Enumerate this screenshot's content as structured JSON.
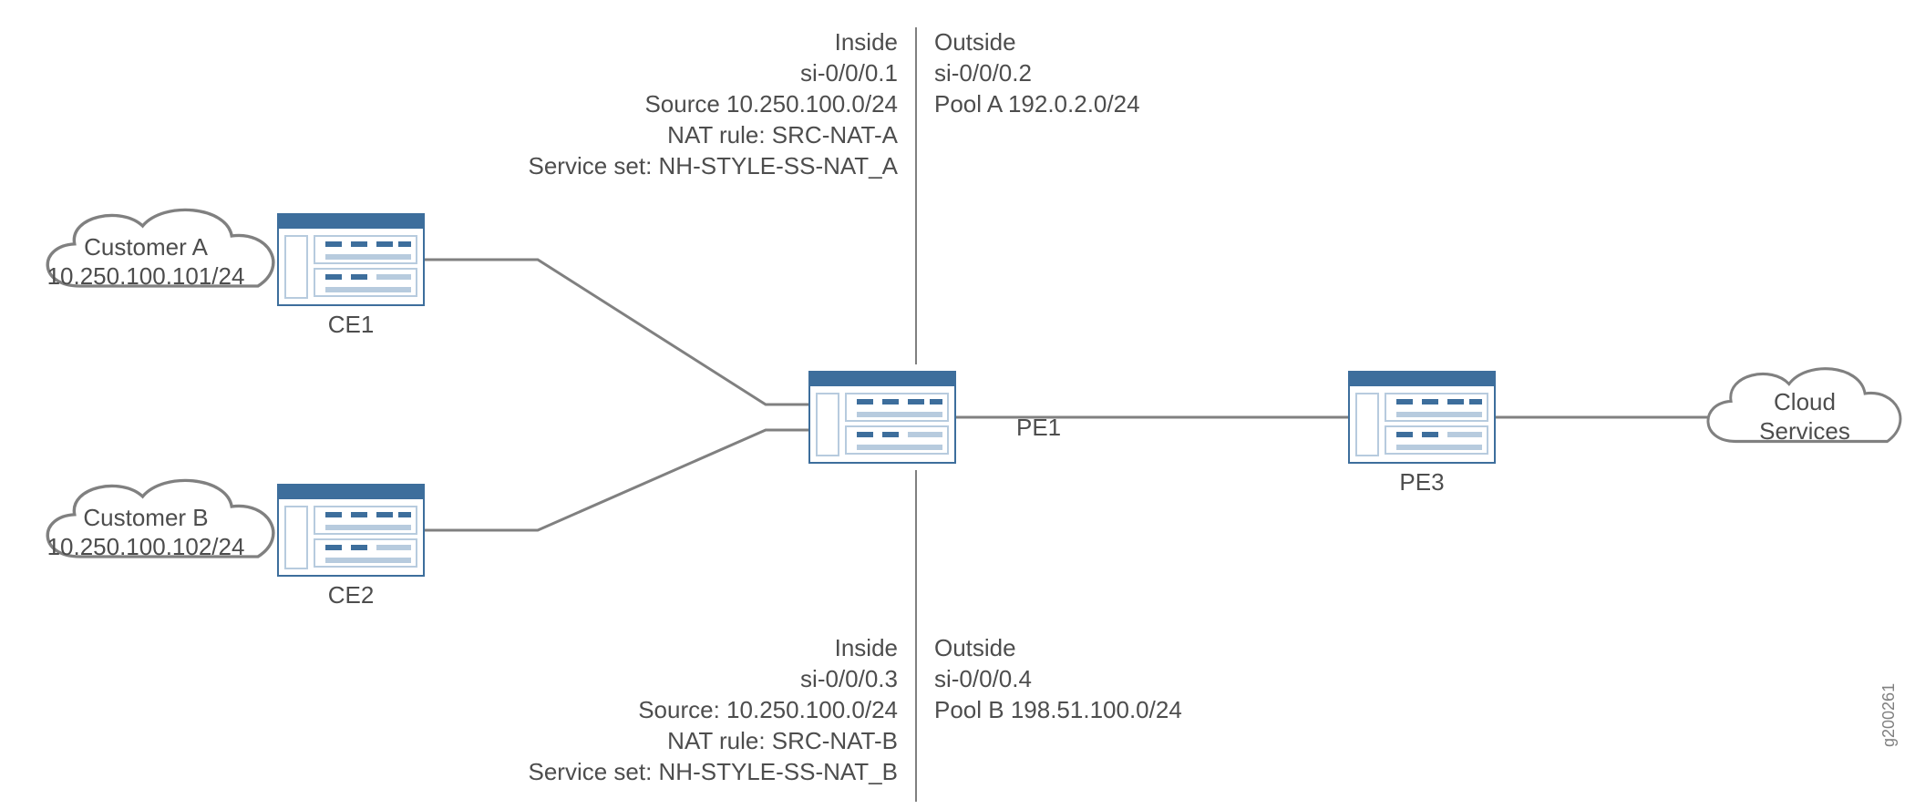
{
  "customers": {
    "a": {
      "name": "Customer A",
      "ip": "10.250.100.101/24"
    },
    "b": {
      "name": "Customer B",
      "ip": "10.250.100.102/24"
    }
  },
  "devices": {
    "ce1": "CE1",
    "ce2": "CE2",
    "pe1": "PE1",
    "pe3": "PE3"
  },
  "cloud_services": "Cloud\nServices",
  "nat_top": {
    "inside": {
      "heading": "Inside",
      "iface": "si-0/0/0.1",
      "source": "Source 10.250.100.0/24",
      "natrule": "NAT rule: SRC-NAT-A",
      "svcset": "Service set: NH-STYLE-SS-NAT_A"
    },
    "outside": {
      "heading": "Outside",
      "iface": "si-0/0/0.2",
      "pool": "Pool A 192.0.2.0/24"
    }
  },
  "nat_bottom": {
    "inside": {
      "heading": "Inside",
      "iface": "si-0/0/0.3",
      "source": "Source: 10.250.100.0/24",
      "natrule": "NAT rule: SRC-NAT-B",
      "svcset": "Service set: NH-STYLE-SS-NAT_B"
    },
    "outside": {
      "heading": "Outside",
      "iface": "si-0/0/0.4",
      "pool": "Pool B 198.51.100.0/24"
    }
  },
  "ref": "g200261"
}
